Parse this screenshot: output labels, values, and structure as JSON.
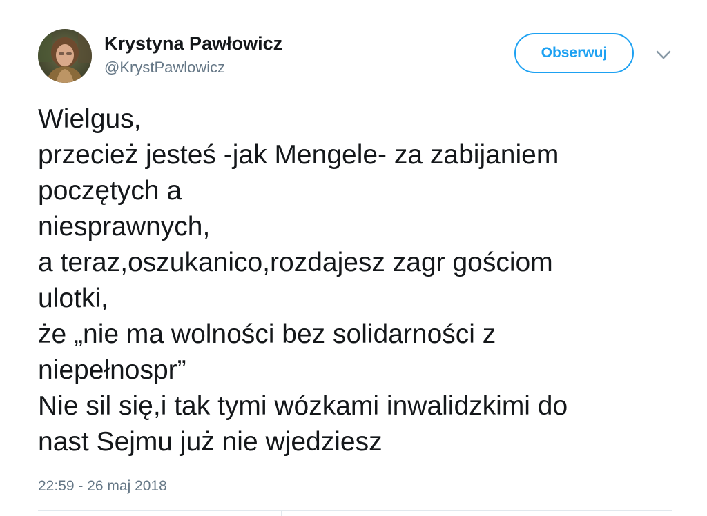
{
  "author": {
    "name": "Krystyna Pawłowicz",
    "handle": "@KrystPawlowicz",
    "avatar_icon": "profile-photo"
  },
  "follow_button": {
    "label": "Obserwuj",
    "color": "#1da1f2"
  },
  "menu_icon": "chevron-down-icon",
  "tweet": {
    "lines": [
      "Wielgus,",
      "przecież jesteś -jak Mengele- za zabijaniem",
      "poczętych a",
      "niesprawnych,",
      "a teraz,oszukanico,rozdajesz zagr gościom",
      "ulotki,",
      "że „nie ma wolności bez solidarności z",
      "niepełnospr”",
      "Nie sil się,i tak tymi wózkami inwalidzkimi do",
      "nast Sejmu już nie wjedziesz"
    ],
    "timestamp": "22:59 - 26 maj 2018"
  },
  "colors": {
    "text": "#14171a",
    "secondary": "#657786",
    "accent": "#1da1f2",
    "divider": "#e1e8ed"
  }
}
